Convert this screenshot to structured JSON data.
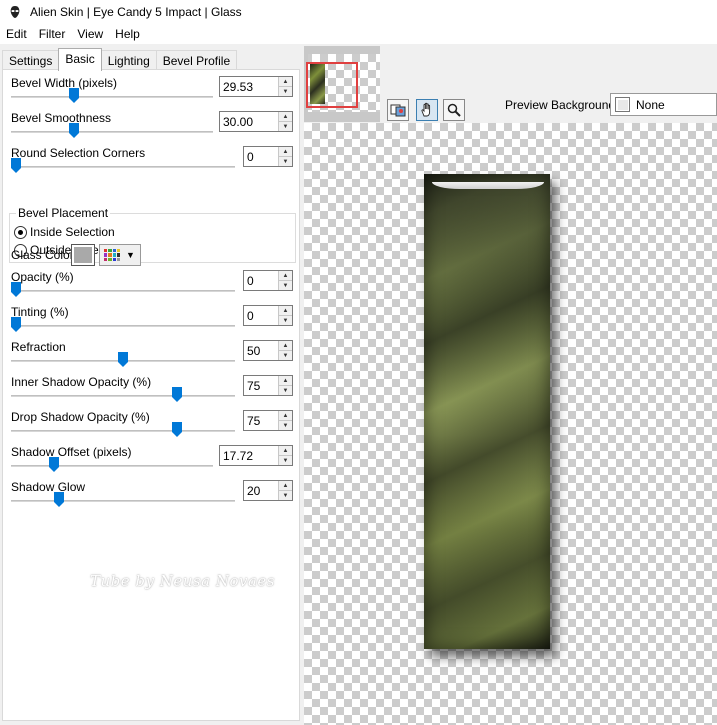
{
  "window": {
    "title": "Alien Skin | Eye Candy 5 Impact | Glass"
  },
  "menu": [
    "Edit",
    "Filter",
    "View",
    "Help"
  ],
  "tabs": [
    {
      "label": "Settings",
      "active": false
    },
    {
      "label": "Basic",
      "active": true
    },
    {
      "label": "Lighting",
      "active": false
    },
    {
      "label": "Bevel Profile",
      "active": false
    }
  ],
  "controls": {
    "bevel_width": {
      "label": "Bevel Width (pixels)",
      "value": "29.53",
      "level": 0.3
    },
    "bevel_smoothness": {
      "label": "Bevel Smoothness",
      "value": "30.00",
      "level": 0.3
    },
    "round_corners": {
      "label": "Round Selection Corners",
      "value": "0",
      "level": 0.0
    },
    "opacity": {
      "label": "Opacity (%)",
      "value": "0",
      "level": 0.0
    },
    "tinting": {
      "label": "Tinting (%)",
      "value": "0",
      "level": 0.0
    },
    "refraction": {
      "label": "Refraction",
      "value": "50",
      "level": 0.5
    },
    "inner_shadow_opacity": {
      "label": "Inner Shadow Opacity (%)",
      "value": "75",
      "level": 0.75
    },
    "drop_shadow_opacity": {
      "label": "Drop Shadow Opacity (%)",
      "value": "75",
      "level": 0.75
    },
    "shadow_offset": {
      "label": "Shadow Offset (pixels)",
      "value": "17.72",
      "level": 0.2
    },
    "shadow_glow": {
      "label": "Shadow Glow",
      "value": "20",
      "level": 0.2
    }
  },
  "bevel_placement": {
    "title": "Bevel Placement",
    "options": [
      {
        "label": "Inside Selection",
        "checked": true
      },
      {
        "label": "Outside Selection",
        "checked": false
      }
    ]
  },
  "glass_color": {
    "label": "Glass Color",
    "color": "#a9a9a9"
  },
  "watermark": "Tube by Neusa Novaes",
  "preview": {
    "background_label": "Preview Background:",
    "background_value": "None"
  },
  "colors": {
    "accent": "#0078d7",
    "nav_box": "#e04040"
  },
  "icons": {
    "app": "alien-skin-icon",
    "tools": [
      "preview-compare-icon",
      "hand-pan-icon",
      "zoom-magnifier-icon"
    ]
  }
}
